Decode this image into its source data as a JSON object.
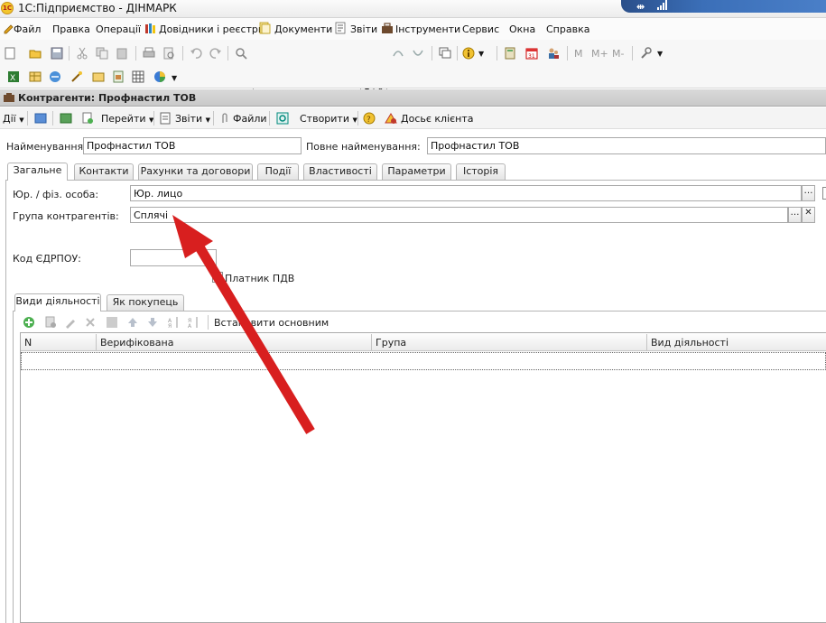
{
  "window": {
    "title": "1С:Підприємство - ДІНМАРК",
    "logo_text": "1С"
  },
  "menu": [
    {
      "label": "Файл",
      "icon": "edit-icon"
    },
    {
      "label": "Правка"
    },
    {
      "label": "Операції"
    },
    {
      "label": "Довідники і реєстри",
      "icon": "books-icon"
    },
    {
      "label": "Документи",
      "icon": "documents-icon"
    },
    {
      "label": "Звіти",
      "icon": "report-icon"
    },
    {
      "label": "Інструменти",
      "icon": "toolbox-icon"
    },
    {
      "label": "Сервис"
    },
    {
      "label": "Окна"
    },
    {
      "label": "Справка"
    }
  ],
  "toolbar": {
    "search_value": "",
    "m_buttons": [
      "M",
      "M+",
      "M-"
    ]
  },
  "form": {
    "title": "Контрагенти: Профнастил ТОВ",
    "commands": {
      "actions": "Дії",
      "goto": "Перейти",
      "reports": "Звіти",
      "files": "Файли",
      "create": "Створити",
      "dossier": "Досьє клієнта"
    },
    "name_label": "Найменування:",
    "name_value": "Профнастил ТОВ",
    "full_name_label": "Повне найменування:",
    "full_name_value": "Профнастил ТОВ",
    "tabs": [
      "Загальне",
      "Контакти",
      "Рахунки та договори",
      "Події",
      "Властивості",
      "Параметри",
      "Історія"
    ],
    "legal_label": "Юр. / фіз. особа:",
    "legal_value": "Юр. лицо",
    "group_label": "Група контрагентів:",
    "group_value": "Сплячі",
    "edrpou_label": "Код ЄДРПОУ:",
    "edrpou_value": "",
    "vat_label": "Платник ПДВ",
    "vat_checked": false,
    "inner_tabs": [
      "Види діяльності",
      "Як покупець"
    ],
    "set_main_label": "Встановити основним",
    "table_columns": [
      "N",
      "Верифікована",
      "Група",
      "Вид діяльності"
    ]
  },
  "colors": {
    "arrow": "#d81f1f",
    "tray": "#3b6fb8",
    "header": "#c9c9c9"
  }
}
